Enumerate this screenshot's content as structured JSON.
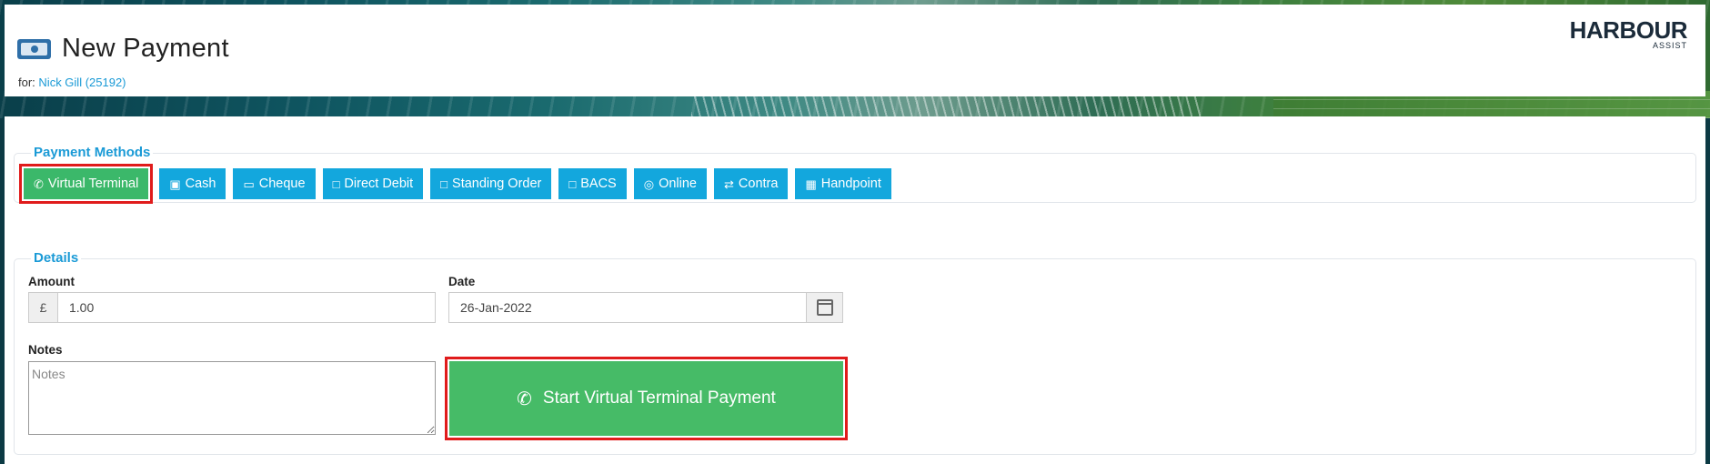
{
  "header": {
    "title": "New Payment",
    "for_prefix": "for:",
    "customer_link": "Nick Gill (25192)",
    "logo_main": "HARBOUR",
    "logo_sub": "ASSIST"
  },
  "payment_methods": {
    "legend": "Payment Methods",
    "buttons": [
      {
        "label": "Virtual Terminal",
        "icon": "phone-icon",
        "active": true
      },
      {
        "label": "Cash",
        "icon": "money-icon"
      },
      {
        "label": "Cheque",
        "icon": "cheque-icon"
      },
      {
        "label": "Direct Debit",
        "icon": "calendar-icon"
      },
      {
        "label": "Standing Order",
        "icon": "calendar-icon"
      },
      {
        "label": "BACS",
        "icon": "calendar-icon"
      },
      {
        "label": "Online",
        "icon": "globe-icon"
      },
      {
        "label": "Contra",
        "icon": "exchange-icon"
      },
      {
        "label": "Handpoint",
        "icon": "calculator-icon"
      }
    ]
  },
  "details": {
    "legend": "Details",
    "amount_label": "Amount",
    "currency_symbol": "£",
    "amount_value": "1.00",
    "date_label": "Date",
    "date_value": "26-Jan-2022",
    "notes_label": "Notes",
    "notes_placeholder": "Notes",
    "start_button": "Start Virtual Terminal Payment"
  },
  "colors": {
    "accent_blue": "#13a7dd",
    "active_green": "#3bb86a",
    "highlight_red": "#e01b1b"
  }
}
